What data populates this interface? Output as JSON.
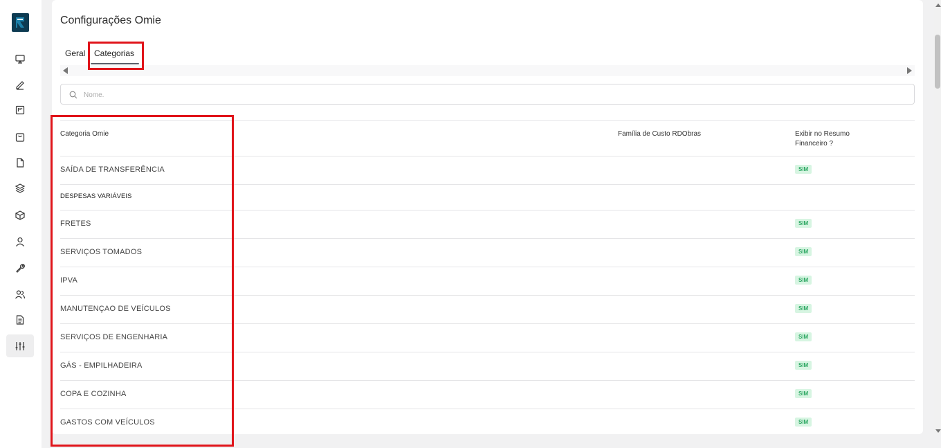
{
  "colors": {
    "highlight": "#e0141a",
    "badge_text": "#2fa864",
    "badge_bg": "#d7f5e2",
    "logo": "#1b7fa8"
  },
  "sidebar": {
    "icons": [
      "monitor-icon",
      "pencil-icon",
      "kanban-icon",
      "shopping-bag-icon",
      "file-icon",
      "layers-icon",
      "box-icon",
      "user-icon",
      "wrench-icon",
      "users-icon",
      "document-icon",
      "sliders-icon"
    ],
    "active": "sliders-icon"
  },
  "page": {
    "title": "Configurações Omie"
  },
  "tabs": [
    {
      "label": "Geral",
      "selected": false
    },
    {
      "label": "Categorias",
      "selected": true
    }
  ],
  "search": {
    "placeholder": "Nome.",
    "value": ""
  },
  "table": {
    "headers": [
      "Categoria Omie",
      "Família de Custo RDObras",
      "Exibir no Resumo Financeiro ?"
    ],
    "rows": [
      {
        "name": "SAÍDA DE TRANSFERÊNCIA",
        "family": "",
        "badge": "SIM",
        "group": false
      },
      {
        "name": "DESPESAS VARIÁVEIS",
        "family": "",
        "badge": "",
        "group": true
      },
      {
        "name": "FRETES",
        "family": "",
        "badge": "SIM",
        "group": false
      },
      {
        "name": "SERVIÇOS TOMADOS",
        "family": "",
        "badge": "SIM",
        "group": false
      },
      {
        "name": "IPVA",
        "family": "",
        "badge": "SIM",
        "group": false
      },
      {
        "name": "MANUTENÇAO DE VEÍCULOS",
        "family": "",
        "badge": "SIM",
        "group": false
      },
      {
        "name": "SERVIÇOS DE ENGENHARIA",
        "family": "",
        "badge": "SIM",
        "group": false
      },
      {
        "name": "GÁS - EMPILHADEIRA",
        "family": "",
        "badge": "SIM",
        "group": false
      },
      {
        "name": "COPA E COZINHA",
        "family": "",
        "badge": "SIM",
        "group": false
      },
      {
        "name": "GASTOS COM VEÍCULOS",
        "family": "",
        "badge": "SIM",
        "group": false
      }
    ]
  }
}
